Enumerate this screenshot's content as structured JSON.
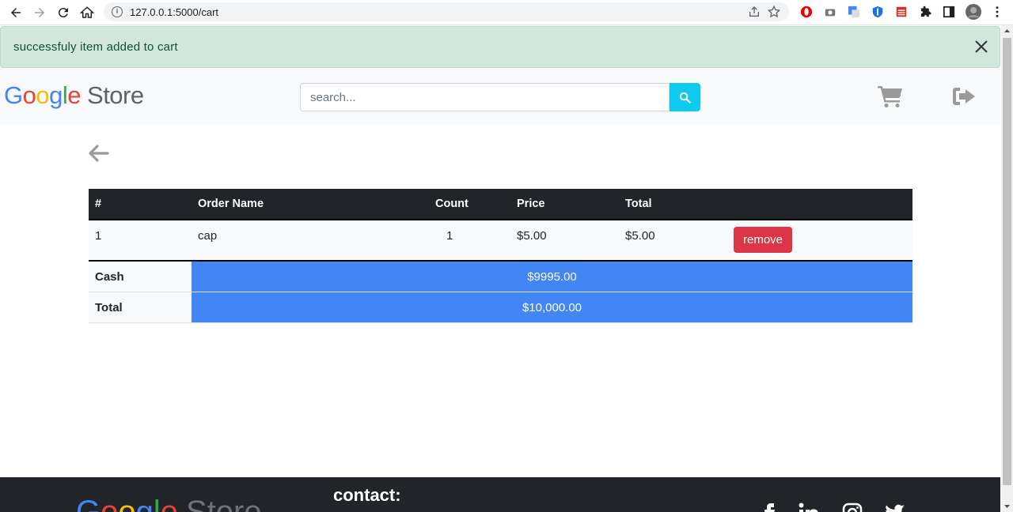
{
  "browser": {
    "url": "127.0.0.1:5000/cart"
  },
  "alert": {
    "message": "successfuly item added to cart"
  },
  "header": {
    "logo_google": [
      "G",
      "o",
      "o",
      "g",
      "l",
      "e"
    ],
    "logo_store": "Store",
    "search_placeholder": "search..."
  },
  "cart": {
    "columns": [
      "#",
      "Order Name",
      "Count",
      "Price",
      "Total",
      ""
    ],
    "rows": [
      {
        "index": "1",
        "name": "cap",
        "count": "1",
        "price": "$5.00",
        "total": "$5.00",
        "action": "remove"
      }
    ]
  },
  "summary": {
    "cash_label": "Cash",
    "cash_value": "$9995.00",
    "total_label": "Total",
    "total_value": "$10,000.00"
  },
  "footer": {
    "logo_store": "Store",
    "contact_title": "contact:"
  },
  "colors": {
    "alert_bg": "#d1e7dd",
    "search_button": "#0dcaf0",
    "table_header": "#212529",
    "remove_button": "#dc3545",
    "summary_value_bg": "#4285f4",
    "footer_bg": "#212529"
  }
}
